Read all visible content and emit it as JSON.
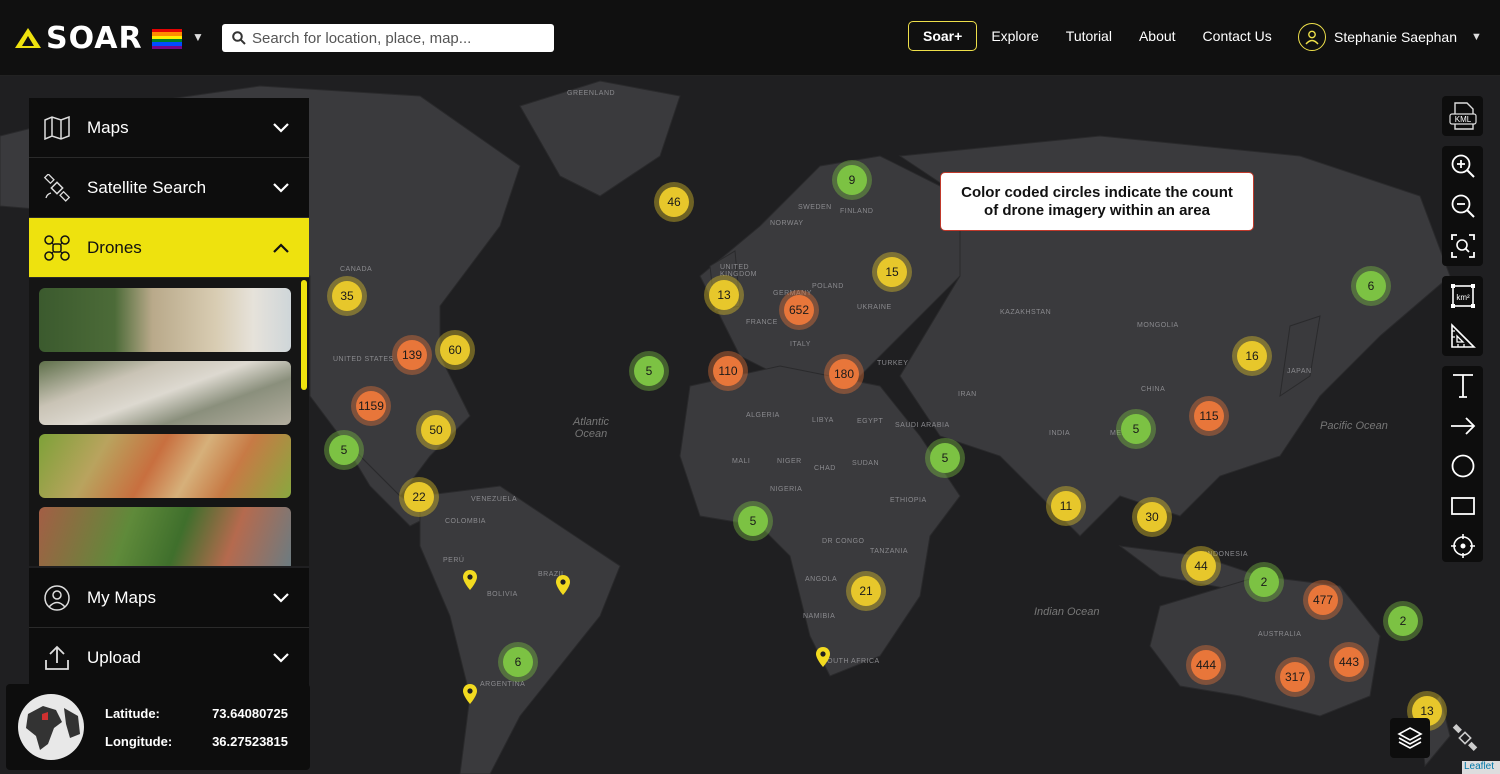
{
  "header": {
    "logo_text": "SOAR",
    "search_placeholder": "Search for location, place, map...",
    "soar_plus_label": "Soar+",
    "nav_links": [
      "Explore",
      "Tutorial",
      "About",
      "Contact Us"
    ],
    "user_name": "Stephanie Saephan"
  },
  "sidebar": {
    "sections": [
      "Maps",
      "Satellite Search",
      "Drones",
      "My Maps",
      "Upload"
    ],
    "active_section": "Drones"
  },
  "callout": "Color coded circles indicate the count of drone imagery within an area",
  "coordinates": {
    "latitude_label": "Latitude:",
    "latitude_value": "73.64080725",
    "longitude_label": "Longitude:",
    "longitude_value": "36.27523815"
  },
  "map": {
    "clusters": [
      {
        "count": "46",
        "color": "yellow"
      },
      {
        "count": "9",
        "color": "green"
      },
      {
        "count": "35",
        "color": "yellow"
      },
      {
        "count": "13",
        "color": "yellow"
      },
      {
        "count": "652",
        "color": "orange"
      },
      {
        "count": "15",
        "color": "yellow"
      },
      {
        "count": "139",
        "color": "orange"
      },
      {
        "count": "60",
        "color": "yellow"
      },
      {
        "count": "5",
        "color": "green"
      },
      {
        "count": "110",
        "color": "orange"
      },
      {
        "count": "180",
        "color": "orange"
      },
      {
        "count": "1159",
        "color": "orange"
      },
      {
        "count": "50",
        "color": "yellow"
      },
      {
        "count": "5",
        "color": "green"
      },
      {
        "count": "22",
        "color": "yellow"
      },
      {
        "count": "5",
        "color": "green"
      },
      {
        "count": "5",
        "color": "green"
      },
      {
        "count": "5",
        "color": "green"
      },
      {
        "count": "115",
        "color": "orange"
      },
      {
        "count": "16",
        "color": "yellow"
      },
      {
        "count": "6",
        "color": "green"
      },
      {
        "count": "11",
        "color": "yellow"
      },
      {
        "count": "30",
        "color": "yellow"
      },
      {
        "count": "44",
        "color": "yellow"
      },
      {
        "count": "2",
        "color": "green"
      },
      {
        "count": "477",
        "color": "orange"
      },
      {
        "count": "2",
        "color": "green"
      },
      {
        "count": "21",
        "color": "yellow"
      },
      {
        "count": "6",
        "color": "green"
      },
      {
        "count": "444",
        "color": "orange"
      },
      {
        "count": "317",
        "color": "orange"
      },
      {
        "count": "443",
        "color": "orange"
      },
      {
        "count": "13",
        "color": "yellow"
      }
    ],
    "cluster_colors": {
      "green": "#7cc243",
      "yellow": "#e7c72b",
      "orange": "#e8763a"
    },
    "place_labels": [
      "GREENLAND",
      "CANADA",
      "UNITED STATES",
      "SWEDEN",
      "FINLAND",
      "NORWAY",
      "UNITED KINGDOM",
      "GERMANY",
      "FRANCE",
      "POLAND",
      "UKRAINE",
      "ITALY",
      "TURKEY",
      "KAZAKHSTAN",
      "MONGOLIA",
      "CHINA",
      "JAPAN",
      "IRAN",
      "INDIA",
      "ALGERIA",
      "LIBYA",
      "EGYPT",
      "SAUDI ARABIA",
      "MALI",
      "NIGER",
      "CHAD",
      "SUDAN",
      "NIGERIA",
      "ETHIOPIA",
      "DR CONGO",
      "TANZANIA",
      "ANGOLA",
      "NAMIBIA",
      "SOUTH AFRICA",
      "VENEZUELA",
      "COLOMBIA",
      "PERÚ",
      "BRAZIL",
      "BOLIVIA",
      "ARGENTINA",
      "INDONESIA",
      "AUSTRALIA",
      "MEXICO"
    ],
    "ocean_labels": [
      "Atlantic Ocean",
      "Pacific Ocean",
      "Indian Ocean"
    ],
    "tool_kml": "KML",
    "tool_area": "km²",
    "attribution": "Leaflet"
  }
}
